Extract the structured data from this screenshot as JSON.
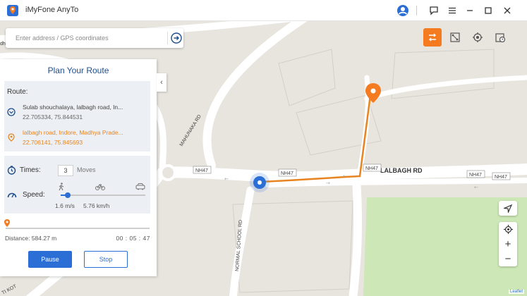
{
  "app": {
    "title": "iMyFone AnyTo",
    "brand_color": "#f47b20",
    "window_controls": [
      "feedback-icon",
      "menu-icon",
      "minimize-icon",
      "maximize-icon",
      "close-icon"
    ]
  },
  "search": {
    "placeholder": "Enter address / GPS coordinates"
  },
  "mode_buttons": [
    {
      "name": "multi-spot-route-icon",
      "active": true
    },
    {
      "name": "jump-teleport-icon",
      "active": false
    },
    {
      "name": "teleport-target-icon",
      "active": false
    },
    {
      "name": "history-icon",
      "active": false
    }
  ],
  "map": {
    "roads": {
      "mahunaka": "MAHUNAKA RD",
      "lalbagh": "LALBAGH RD",
      "normal_school": "NORMAL SCHOOL RD",
      "nh47_a": "NH47",
      "nh47_b": "NH47",
      "nh47_c": "NH47",
      "nh47_d": "NH47",
      "nh47_e": "NH47",
      "corner_top": "8",
      "corner_left": "dhi",
      "bottom_left": "TI KOT"
    },
    "attribution": "Leaflet",
    "route_color": "#e8841f"
  },
  "panel": {
    "title": "Plan Your Route",
    "collapse_glyph": "‹",
    "route_label": "Route:",
    "start": {
      "name": "Sulab shouchalaya, lalbagh road, In...",
      "coords": "22.705334, 75.844531"
    },
    "end": {
      "name": "lalbagh road, Indore, Madhya Prade...",
      "coords": "22.706141, 75.845693"
    },
    "times_label": "Times:",
    "times_value": "3",
    "moves_label": "Moves",
    "speed_label": "Speed:",
    "speed_fraction": 0.08,
    "speed_ms": "1.6 m/s",
    "speed_kmh": "5.76 km/h",
    "progress_fraction": 0.0,
    "distance": "Distance: 584.27 m",
    "elapsed": "00 : 05 : 47",
    "pause_label": "Pause",
    "stop_label": "Stop"
  }
}
